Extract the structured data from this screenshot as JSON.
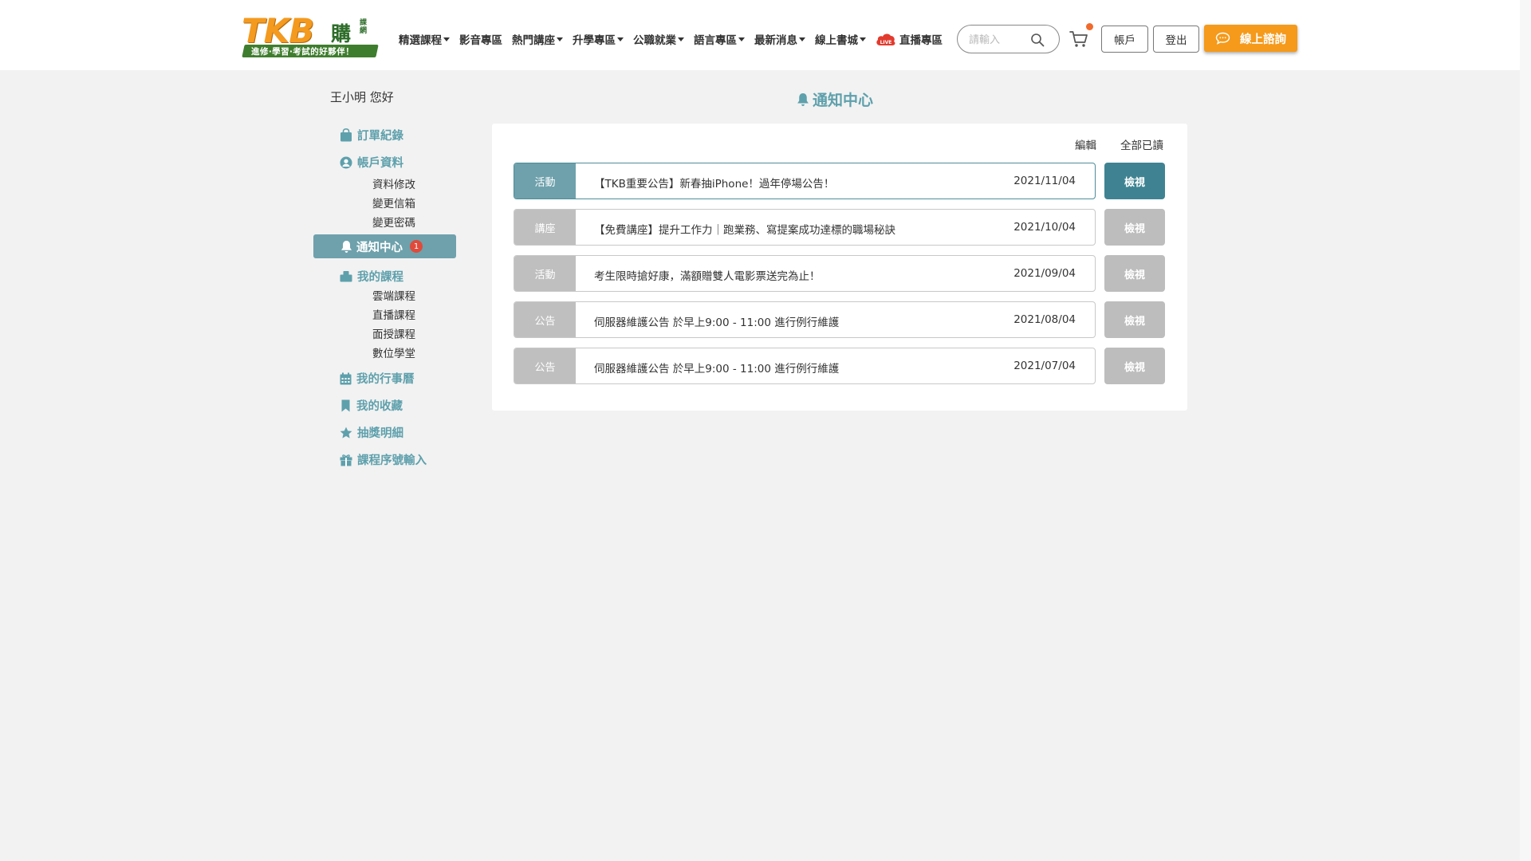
{
  "header": {
    "logo": {
      "text": "TKB",
      "buy": "購",
      "course": "課網",
      "slogan": "進修‧學習‧考試的好夥伴！"
    },
    "nav": [
      {
        "label": "精選課程",
        "dropdown": true
      },
      {
        "label": "影音專區",
        "dropdown": false
      },
      {
        "label": "熱門講座",
        "dropdown": true
      },
      {
        "label": "升學專區",
        "dropdown": true
      },
      {
        "label": "公職就業",
        "dropdown": true
      },
      {
        "label": "語言專區",
        "dropdown": true
      },
      {
        "label": "最新消息",
        "dropdown": true
      },
      {
        "label": "線上書城",
        "dropdown": true
      },
      {
        "label": "直播專區",
        "dropdown": false,
        "icon": "live-cloud-icon"
      }
    ],
    "search": {
      "placeholder": "請輸入",
      "value": ""
    },
    "cart": {
      "icon": "cart-icon",
      "has_notification": true
    },
    "account_label": "帳戶",
    "logout_label": "登出",
    "consult_label": "線上諮詢"
  },
  "sidebar": {
    "greeting": "王小明  您好",
    "orders": "訂單紀錄",
    "account": {
      "label": "帳戶資料",
      "sub": [
        "資料修改",
        "變更信箱",
        "變更密碼"
      ]
    },
    "notify": {
      "label": "通知中心",
      "badge": "1"
    },
    "courses": {
      "label": "我的課程",
      "sub": [
        "雲端課程",
        "直播課程",
        "面授課程",
        "數位學堂"
      ]
    },
    "calendar": "我的行事曆",
    "favorites": "我的收藏",
    "lottery": "抽獎明細",
    "serial": "課程序號輸入"
  },
  "main": {
    "title": "通知中心",
    "edit_label": "編輯",
    "read_all_label": "全部已讀",
    "view_label": "檢視",
    "notices": [
      {
        "tag": "活動",
        "title": "【TKB重要公告】新春抽iPhone！過年停場公告！",
        "date": "2021/11/04",
        "unread": true
      },
      {
        "tag": "講座",
        "title": "【免費講座】提升工作力｜跑業務、寫提案成功達標的職場秘訣",
        "date": "2021/10/04",
        "unread": false
      },
      {
        "tag": "活動",
        "title": "考生限時搶好康，滿額贈雙人電影票送完為止！",
        "date": "2021/09/04",
        "unread": false
      },
      {
        "tag": "公告",
        "title": "伺服器維護公告  於早上9:00 - 11:00 進行例行維護",
        "date": "2021/08/04",
        "unread": false
      },
      {
        "tag": "公告",
        "title": "伺服器維護公告  於早上9:00 - 11:00 進行例行維護",
        "date": "2021/07/04",
        "unread": false
      }
    ]
  },
  "colors": {
    "accent": "#5ea0ac",
    "active_bg": "#6ea1ac",
    "view_active": "#3f8392",
    "inactive": "#bfbfbf",
    "orange": "#f59a1b",
    "badge": "#e04a3a"
  }
}
